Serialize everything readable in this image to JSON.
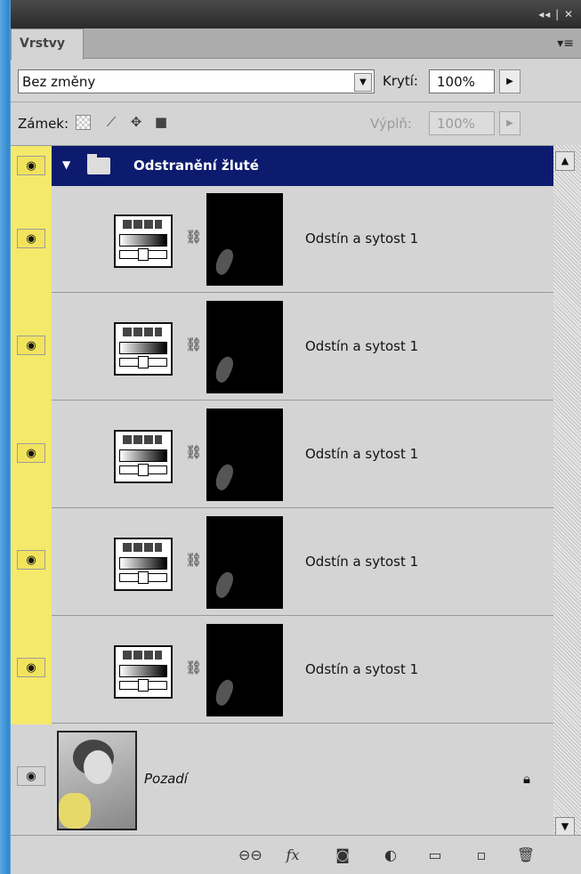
{
  "panel": {
    "tab_label": "Vrstvy",
    "menu_icon": "▾≡",
    "title_controls": "◂◂ | ✕"
  },
  "blend": {
    "mode": "Bez změny",
    "opacity_label": "Krytí:",
    "opacity_value": "100%"
  },
  "lock": {
    "label": "Zámek:",
    "fill_label": "Výplň:",
    "fill_value": "100%"
  },
  "group": {
    "name": "Odstranění žluté"
  },
  "layers": [
    {
      "name": "Odstín a sytost 1"
    },
    {
      "name": "Odstín a sytost 1"
    },
    {
      "name": "Odstín a sytost 1"
    },
    {
      "name": "Odstín a sytost 1"
    },
    {
      "name": "Odstín a sytost 1"
    }
  ],
  "background": {
    "name": "Pozadí"
  },
  "toolbar": {
    "fx_label": "fx"
  },
  "colors": {
    "group_selected": "#0d1b6f",
    "visibility_highlight": "#f5e96b"
  },
  "icons": [
    "eye-icon",
    "folder-icon",
    "link-icon",
    "lock-icon",
    "brush-icon",
    "move-icon",
    "transparency-lock-icon",
    "new-layer-icon",
    "trash-icon",
    "mask-icon",
    "adjustment-icon"
  ]
}
